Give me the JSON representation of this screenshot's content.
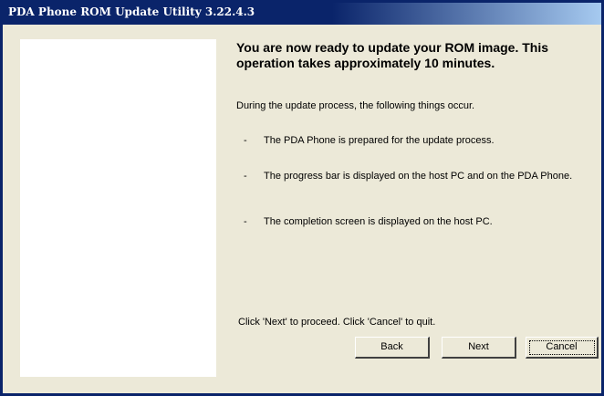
{
  "window": {
    "title": "PDA Phone ROM Update Utility 3.22.4.3"
  },
  "main": {
    "heading": "You are now ready to update your ROM image. This operation takes approximately 10 minutes.",
    "intro": "During the update process, the following things occur.",
    "steps": [
      {
        "dash": "-",
        "text": "The PDA Phone is prepared for the update process."
      },
      {
        "dash": "-",
        "text": "The progress bar is displayed on the host PC and on the PDA Phone."
      },
      {
        "dash": "-",
        "text": "The completion screen is displayed on the host PC."
      }
    ],
    "footer": "Click 'Next' to proceed. Click 'Cancel' to quit."
  },
  "buttons": {
    "back": "Back",
    "next": "Next",
    "cancel": "Cancel"
  },
  "colors": {
    "titlebar": "#0A246A",
    "dialog_bg": "#ECE9D8",
    "panel_bg": "#FFFFFF"
  }
}
